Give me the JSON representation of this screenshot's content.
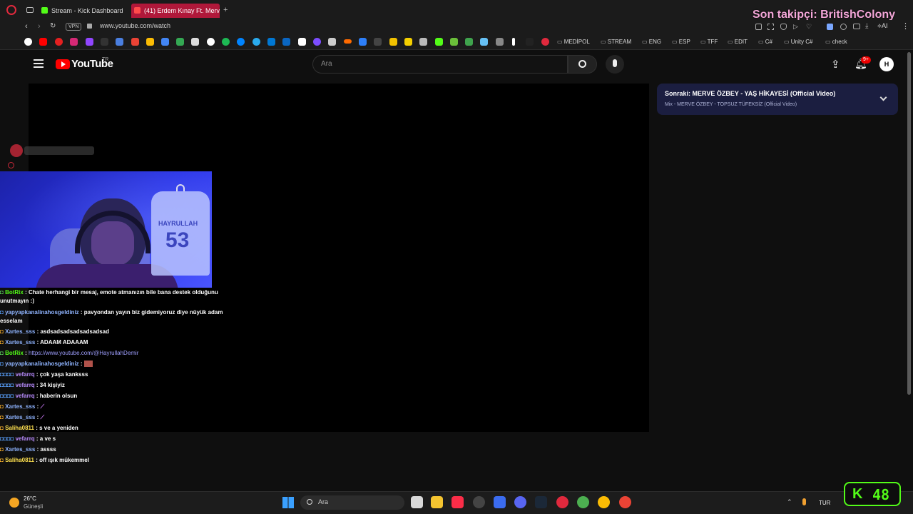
{
  "browser": {
    "tabs": [
      {
        "title": "Stream - Kick Dashboard",
        "favicon_color": "#53fc18",
        "active": false
      },
      {
        "title": "(41) Erdem Kınay Ft. Merve",
        "favicon_color": "#ff0000",
        "active": true
      }
    ],
    "new_tab_label": "+",
    "vpn_badge": "VPN",
    "url": "www.youtube.com/watch",
    "bookmark_folders": [
      "MEDİPOL",
      "STREAM",
      "ENG",
      "ESP",
      "TFF",
      "EDIT",
      "C#",
      "Unity C#",
      "check"
    ],
    "ai_label": "AI"
  },
  "overlay": {
    "follower_text": "Son takipçi: BritishColony",
    "kick_viewers": "48"
  },
  "youtube": {
    "logo_text": "YouTube",
    "country": "TR",
    "search_placeholder": "Ara",
    "notification_badge": "9+",
    "avatar_letter": "H",
    "next_title": "Sonraki: MERVE ÖZBEY - YAŞ HİKAYESİ (Official Video)",
    "next_subtitle": "Mix - MERVE ÖZBEY - TOPSUZ TÜFEKSİZ (Official Video)"
  },
  "webcam": {
    "jersey_name": "HAYRULLAH",
    "jersey_number": "53"
  },
  "chat": [
    {
      "user": "BotRix",
      "sep": " : ",
      "text": "Chate herhangi bir mesaj, emote atmanızın bile bana destek olduğunu",
      "color": "green"
    },
    {
      "user": "",
      "sep": "",
      "text": "unutmayın :)",
      "color": "none"
    },
    {
      "user": "yapyapkanalinahosgeldiniz",
      "sep": " : ",
      "text": "pavyondan yayın biz gidemiyoruz diye nüyük adam",
      "color": "blue"
    },
    {
      "user": "",
      "sep": "",
      "text": "esselam",
      "color": "none"
    },
    {
      "user": "Xartes_sss",
      "sep": " : ",
      "text": "asdsadsadsadsadsadsad",
      "color": "blue"
    },
    {
      "user": "Xartes_sss",
      "sep": " : ",
      "text": "ADAAM ADAAAM",
      "color": "blue"
    },
    {
      "user": "BotRix",
      "sep": " : ",
      "text": "https://www.youtube.com/@HayrullahDemir",
      "color": "green"
    },
    {
      "user": "yapyapkanalinahosgeldiniz",
      "sep": " : ",
      "text": "",
      "color": "blue"
    },
    {
      "user": "vefarrq",
      "sep": " : ",
      "text": "çok yaşa kanksss",
      "color": "purple"
    },
    {
      "user": "vefarrq",
      "sep": " : ",
      "text": "34 kişiyiz",
      "color": "purple"
    },
    {
      "user": "vefarrq",
      "sep": " : ",
      "text": "haberin olsun",
      "color": "purple"
    },
    {
      "user": "Xartes_sss",
      "sep": " : ",
      "text": "",
      "color": "blue"
    },
    {
      "user": "Xartes_sss",
      "sep": " : ",
      "text": "",
      "color": "blue"
    },
    {
      "user": "Saliha0811",
      "sep": " : ",
      "text": "s ve a yeniden",
      "color": "yellow"
    },
    {
      "user": "vefarrq",
      "sep": " : ",
      "text": "a ve s",
      "color": "purple"
    },
    {
      "user": "Xartes_sss",
      "sep": " : ",
      "text": "assss",
      "color": "blue"
    },
    {
      "user": "Saliha0811",
      "sep": " : ",
      "text": "off ışık mükemmel",
      "color": "yellow"
    }
  ],
  "taskbar": {
    "weather_temp": "26°C",
    "weather_desc": "Güneşli",
    "search_placeholder": "Ara",
    "language": "TUR"
  },
  "colors": {
    "kick_green": "#53fc18",
    "youtube_red": "#ff0000",
    "follower_pink": "#f3a6d8",
    "next_card_bg": "#1b1e40"
  }
}
